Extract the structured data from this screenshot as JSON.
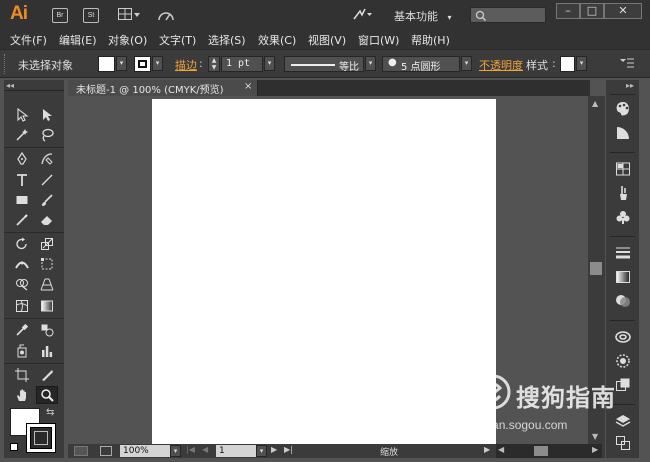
{
  "app": {
    "logo": "Ai",
    "bridge_btn": "Br",
    "stock_btn": "St",
    "workspace": "基本功能",
    "search_placeholder": ""
  },
  "menu": [
    "文件(F)",
    "编辑(E)",
    "对象(O)",
    "文字(T)",
    "选择(S)",
    "效果(C)",
    "视图(V)",
    "窗口(W)",
    "帮助(H)"
  ],
  "control": {
    "selection_status": "未选择对象",
    "stroke_label": "描边",
    "stroke_weight": "1 pt",
    "stroke_profile": "等比",
    "brush_label": "5 点圆形",
    "opacity_label": "不透明度",
    "style_label": "样式"
  },
  "document": {
    "tab_title": "未标题-1 @ 100% (CMYK/预览)",
    "close": "×"
  },
  "status": {
    "zoom": "100%",
    "page": "1",
    "label": "缩放"
  },
  "watermark": {
    "main": "搜狗指南",
    "sub": "zhinan.sogou.com"
  },
  "colors": {
    "accent": "#f08a24",
    "link": "#f0a23c",
    "panel": "#3b3b3b",
    "canvas": "#535353",
    "artboard": "#ffffff"
  }
}
